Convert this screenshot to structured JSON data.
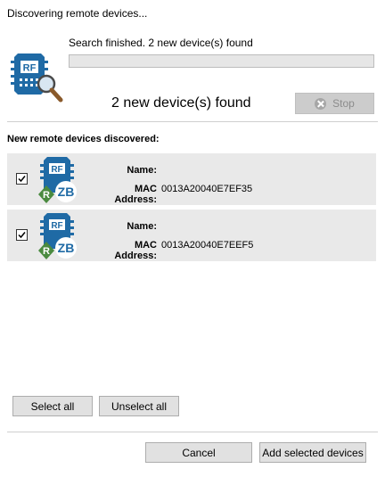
{
  "window": {
    "title": "Discovering remote devices..."
  },
  "search": {
    "status": "Search finished. 2 new device(s) found",
    "progress": 0,
    "summary": "2 new device(s) found",
    "stop_label": "Stop"
  },
  "devices_section": {
    "heading": "New remote devices discovered:",
    "name_label": "Name:",
    "mac_label": "MAC Address:",
    "devices": [
      {
        "checked": true,
        "name": "",
        "mac": "0013A20040E7EF35"
      },
      {
        "checked": true,
        "name": "",
        "mac": "0013A20040E7EEF5"
      }
    ]
  },
  "buttons": {
    "select_all": "Select all",
    "unselect_all": "Unselect all",
    "cancel": "Cancel",
    "add_selected": "Add selected devices"
  },
  "icons": {
    "search": "rf-module-search-icon",
    "device": "rf-zigbee-device-icon",
    "stop": "stop-circle-icon",
    "check": "checkmark-icon"
  },
  "colors": {
    "accent_blue": "#1f6aa5",
    "zigbee_green": "#4a8a3f",
    "row_background": "#e9e9e9"
  }
}
